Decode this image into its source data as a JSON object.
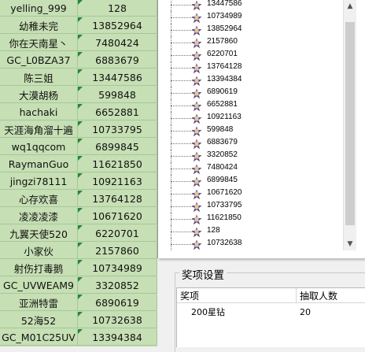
{
  "sheet_rows": [
    {
      "name": "yelling_999",
      "id": "128"
    },
    {
      "name": "幼稚未完",
      "id": "13852964"
    },
    {
      "name": "你在天南星丶",
      "id": "7480424"
    },
    {
      "name": "GC_L0BZA37",
      "id": "6883679"
    },
    {
      "name": "陈三姐",
      "id": "13447586"
    },
    {
      "name": "大漠胡杨",
      "id": "599848"
    },
    {
      "name": "hachaki",
      "id": "6652881"
    },
    {
      "name": "天涯海角溜十遍",
      "id": "10733795"
    },
    {
      "name": "wq1qqcom",
      "id": "6899845"
    },
    {
      "name": "RaymanGuo",
      "id": "11621850"
    },
    {
      "name": "jingzi78111",
      "id": "10921163"
    },
    {
      "name": "心存欢喜",
      "id": "13764128"
    },
    {
      "name": "凌凌凌漆",
      "id": "10671620"
    },
    {
      "name": "九翼天使520",
      "id": "6220701"
    },
    {
      "name": "小家伙",
      "id": "2157860"
    },
    {
      "name": "射伤打毒鹅",
      "id": "10734989"
    },
    {
      "name": "GC_UVWEAM9",
      "id": "3320852"
    },
    {
      "name": "亚洲特雷",
      "id": "6890619"
    },
    {
      "name": "52海52",
      "id": "10732638"
    },
    {
      "name": "GC_M01C25UV",
      "id": "13394384"
    }
  ],
  "tree_items": [
    "13447586",
    "10734989",
    "13852964",
    "2157860",
    "6220701",
    "13764128",
    "13394384",
    "6890619",
    "6652881",
    "10921163",
    "599848",
    "6883679",
    "3320852",
    "7480424",
    "6899845",
    "10671620",
    "10733795",
    "11621850",
    "128",
    "10732638"
  ],
  "scrollbar": {
    "up_icon": "▲",
    "down_icon": "▼"
  },
  "prize_group": {
    "title": "奖项设置",
    "columns": [
      "奖项",
      "抽取人数"
    ],
    "rows": [
      {
        "prize": "200星钻",
        "count": "20"
      }
    ]
  },
  "colors": {
    "sheet_bg": "#c6dfb4",
    "marker": "#1f8a3a",
    "icon_purple": "#5a3d7a"
  }
}
